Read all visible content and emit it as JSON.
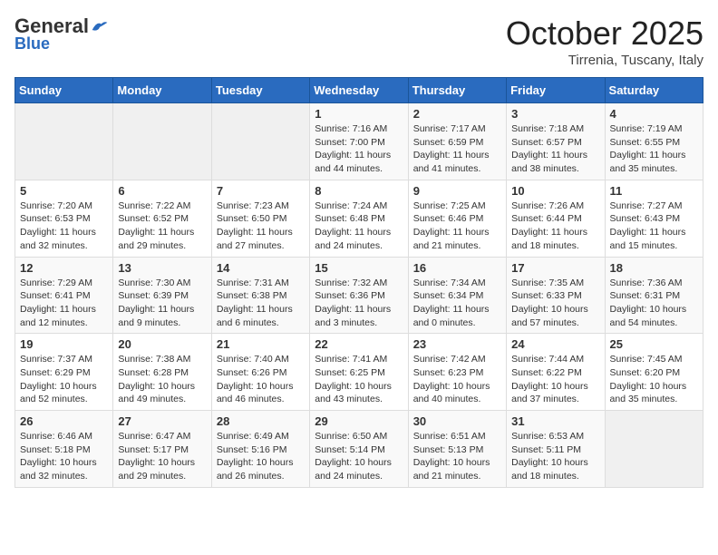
{
  "logo": {
    "general": "General",
    "blue": "Blue"
  },
  "header": {
    "month": "October 2025",
    "location": "Tirrenia, Tuscany, Italy"
  },
  "weekdays": [
    "Sunday",
    "Monday",
    "Tuesday",
    "Wednesday",
    "Thursday",
    "Friday",
    "Saturday"
  ],
  "weeks": [
    [
      {
        "day": "",
        "sunrise": "",
        "sunset": "",
        "daylight": ""
      },
      {
        "day": "",
        "sunrise": "",
        "sunset": "",
        "daylight": ""
      },
      {
        "day": "",
        "sunrise": "",
        "sunset": "",
        "daylight": ""
      },
      {
        "day": "1",
        "sunrise": "Sunrise: 7:16 AM",
        "sunset": "Sunset: 7:00 PM",
        "daylight": "Daylight: 11 hours and 44 minutes."
      },
      {
        "day": "2",
        "sunrise": "Sunrise: 7:17 AM",
        "sunset": "Sunset: 6:59 PM",
        "daylight": "Daylight: 11 hours and 41 minutes."
      },
      {
        "day": "3",
        "sunrise": "Sunrise: 7:18 AM",
        "sunset": "Sunset: 6:57 PM",
        "daylight": "Daylight: 11 hours and 38 minutes."
      },
      {
        "day": "4",
        "sunrise": "Sunrise: 7:19 AM",
        "sunset": "Sunset: 6:55 PM",
        "daylight": "Daylight: 11 hours and 35 minutes."
      }
    ],
    [
      {
        "day": "5",
        "sunrise": "Sunrise: 7:20 AM",
        "sunset": "Sunset: 6:53 PM",
        "daylight": "Daylight: 11 hours and 32 minutes."
      },
      {
        "day": "6",
        "sunrise": "Sunrise: 7:22 AM",
        "sunset": "Sunset: 6:52 PM",
        "daylight": "Daylight: 11 hours and 29 minutes."
      },
      {
        "day": "7",
        "sunrise": "Sunrise: 7:23 AM",
        "sunset": "Sunset: 6:50 PM",
        "daylight": "Daylight: 11 hours and 27 minutes."
      },
      {
        "day": "8",
        "sunrise": "Sunrise: 7:24 AM",
        "sunset": "Sunset: 6:48 PM",
        "daylight": "Daylight: 11 hours and 24 minutes."
      },
      {
        "day": "9",
        "sunrise": "Sunrise: 7:25 AM",
        "sunset": "Sunset: 6:46 PM",
        "daylight": "Daylight: 11 hours and 21 minutes."
      },
      {
        "day": "10",
        "sunrise": "Sunrise: 7:26 AM",
        "sunset": "Sunset: 6:44 PM",
        "daylight": "Daylight: 11 hours and 18 minutes."
      },
      {
        "day": "11",
        "sunrise": "Sunrise: 7:27 AM",
        "sunset": "Sunset: 6:43 PM",
        "daylight": "Daylight: 11 hours and 15 minutes."
      }
    ],
    [
      {
        "day": "12",
        "sunrise": "Sunrise: 7:29 AM",
        "sunset": "Sunset: 6:41 PM",
        "daylight": "Daylight: 11 hours and 12 minutes."
      },
      {
        "day": "13",
        "sunrise": "Sunrise: 7:30 AM",
        "sunset": "Sunset: 6:39 PM",
        "daylight": "Daylight: 11 hours and 9 minutes."
      },
      {
        "day": "14",
        "sunrise": "Sunrise: 7:31 AM",
        "sunset": "Sunset: 6:38 PM",
        "daylight": "Daylight: 11 hours and 6 minutes."
      },
      {
        "day": "15",
        "sunrise": "Sunrise: 7:32 AM",
        "sunset": "Sunset: 6:36 PM",
        "daylight": "Daylight: 11 hours and 3 minutes."
      },
      {
        "day": "16",
        "sunrise": "Sunrise: 7:34 AM",
        "sunset": "Sunset: 6:34 PM",
        "daylight": "Daylight: 11 hours and 0 minutes."
      },
      {
        "day": "17",
        "sunrise": "Sunrise: 7:35 AM",
        "sunset": "Sunset: 6:33 PM",
        "daylight": "Daylight: 10 hours and 57 minutes."
      },
      {
        "day": "18",
        "sunrise": "Sunrise: 7:36 AM",
        "sunset": "Sunset: 6:31 PM",
        "daylight": "Daylight: 10 hours and 54 minutes."
      }
    ],
    [
      {
        "day": "19",
        "sunrise": "Sunrise: 7:37 AM",
        "sunset": "Sunset: 6:29 PM",
        "daylight": "Daylight: 10 hours and 52 minutes."
      },
      {
        "day": "20",
        "sunrise": "Sunrise: 7:38 AM",
        "sunset": "Sunset: 6:28 PM",
        "daylight": "Daylight: 10 hours and 49 minutes."
      },
      {
        "day": "21",
        "sunrise": "Sunrise: 7:40 AM",
        "sunset": "Sunset: 6:26 PM",
        "daylight": "Daylight: 10 hours and 46 minutes."
      },
      {
        "day": "22",
        "sunrise": "Sunrise: 7:41 AM",
        "sunset": "Sunset: 6:25 PM",
        "daylight": "Daylight: 10 hours and 43 minutes."
      },
      {
        "day": "23",
        "sunrise": "Sunrise: 7:42 AM",
        "sunset": "Sunset: 6:23 PM",
        "daylight": "Daylight: 10 hours and 40 minutes."
      },
      {
        "day": "24",
        "sunrise": "Sunrise: 7:44 AM",
        "sunset": "Sunset: 6:22 PM",
        "daylight": "Daylight: 10 hours and 37 minutes."
      },
      {
        "day": "25",
        "sunrise": "Sunrise: 7:45 AM",
        "sunset": "Sunset: 6:20 PM",
        "daylight": "Daylight: 10 hours and 35 minutes."
      }
    ],
    [
      {
        "day": "26",
        "sunrise": "Sunrise: 6:46 AM",
        "sunset": "Sunset: 5:18 PM",
        "daylight": "Daylight: 10 hours and 32 minutes."
      },
      {
        "day": "27",
        "sunrise": "Sunrise: 6:47 AM",
        "sunset": "Sunset: 5:17 PM",
        "daylight": "Daylight: 10 hours and 29 minutes."
      },
      {
        "day": "28",
        "sunrise": "Sunrise: 6:49 AM",
        "sunset": "Sunset: 5:16 PM",
        "daylight": "Daylight: 10 hours and 26 minutes."
      },
      {
        "day": "29",
        "sunrise": "Sunrise: 6:50 AM",
        "sunset": "Sunset: 5:14 PM",
        "daylight": "Daylight: 10 hours and 24 minutes."
      },
      {
        "day": "30",
        "sunrise": "Sunrise: 6:51 AM",
        "sunset": "Sunset: 5:13 PM",
        "daylight": "Daylight: 10 hours and 21 minutes."
      },
      {
        "day": "31",
        "sunrise": "Sunrise: 6:53 AM",
        "sunset": "Sunset: 5:11 PM",
        "daylight": "Daylight: 10 hours and 18 minutes."
      },
      {
        "day": "",
        "sunrise": "",
        "sunset": "",
        "daylight": ""
      }
    ]
  ]
}
